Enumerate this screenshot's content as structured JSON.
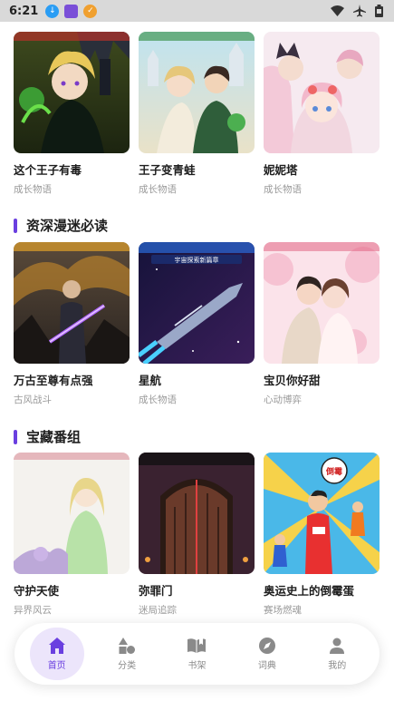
{
  "status_bar": {
    "time": "6:21"
  },
  "sections": [
    {
      "title": "",
      "items": [
        {
          "title": "这个王子有毒",
          "genre": "成长物语"
        },
        {
          "title": "王子变青蛙",
          "genre": "成长物语"
        },
        {
          "title": "妮妮塔",
          "genre": "成长物语"
        }
      ]
    },
    {
      "title": "资深漫迷必读",
      "items": [
        {
          "title": "万古至尊有点强",
          "genre": "古风战斗"
        },
        {
          "title": "星航",
          "genre": "成长物语"
        },
        {
          "title": "宝贝你好甜",
          "genre": "心动博弈"
        }
      ]
    },
    {
      "title": "宝藏番组",
      "items": [
        {
          "title": "守护天使",
          "genre": "异界风云"
        },
        {
          "title": "弥罪门",
          "genre": "迷局追踪"
        },
        {
          "title": "奥运史上的倒霉蛋",
          "genre": "赛场燃魂"
        }
      ]
    }
  ],
  "cover_texts": {
    "xinghang_banner": "宇宙探索新篇章",
    "olympic_badge": "倒霉"
  },
  "bottom_nav": [
    {
      "label": "首页",
      "icon": "home-icon",
      "active": true
    },
    {
      "label": "分类",
      "icon": "category-icon",
      "active": false
    },
    {
      "label": "书架",
      "icon": "bookshelf-icon",
      "active": false
    },
    {
      "label": "词典",
      "icon": "compass-icon",
      "active": false
    },
    {
      "label": "我的",
      "icon": "profile-icon",
      "active": false
    }
  ],
  "colors": {
    "accent": "#6a3fe0",
    "active_bg": "#ece5fb"
  }
}
